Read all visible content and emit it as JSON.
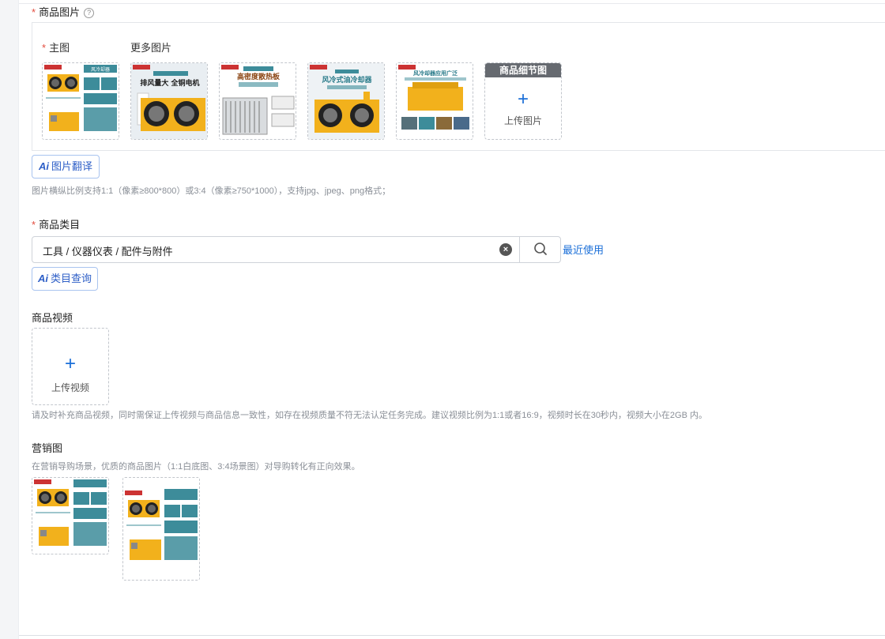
{
  "product_images": {
    "label": "商品图片",
    "required": "*",
    "help": "?",
    "main_label": "主图",
    "more_label": "更多图片",
    "detail_head": "商品细节图",
    "upload_label": "上传图片",
    "upload_plus": "+",
    "thumbs": [
      {
        "header": "风冷却器",
        "caption": ""
      },
      {
        "header": "排风量大 全铜电机",
        "caption": ""
      },
      {
        "header": "高密度散热板",
        "caption": ""
      },
      {
        "header": "风冷式油冷却器",
        "caption": ""
      },
      {
        "header": "风冷却器应用广泛",
        "caption": ""
      }
    ]
  },
  "ai_translate": {
    "icon": "Ai",
    "label": "图片翻译"
  },
  "image_hint": "图片横纵比例支持1:1（像素≥800*800）或3:4（像素≥750*1000），支持jpg、jpeg、png格式；",
  "category": {
    "label": "商品类目",
    "required": "*",
    "value": "工具 / 仪器仪表 / 配件与附件",
    "clear": "×",
    "recent_link": "最近使用"
  },
  "ai_category": {
    "icon": "Ai",
    "label": "类目查询"
  },
  "video": {
    "label": "商品视频",
    "upload_label": "上传视频",
    "upload_plus": "+",
    "hint": "请及时补充商品视频，同时需保证上传视频与商品信息一致性，如存在视频质量不符无法认定任务完成。建议视频比例为1:1或者16:9，视频时长在30秒内，视频大小在2GB 内。"
  },
  "marketing": {
    "label": "营销图",
    "hint": "在营销导购场景，优质的商品图片（1:1白底图、3:4场景图）对导购转化有正向效果。"
  },
  "colors": {
    "accent": "#1b6fd8",
    "required": "#e34d3f",
    "product_yellow": "#f2b11c",
    "teal": "#3d8c9a"
  }
}
